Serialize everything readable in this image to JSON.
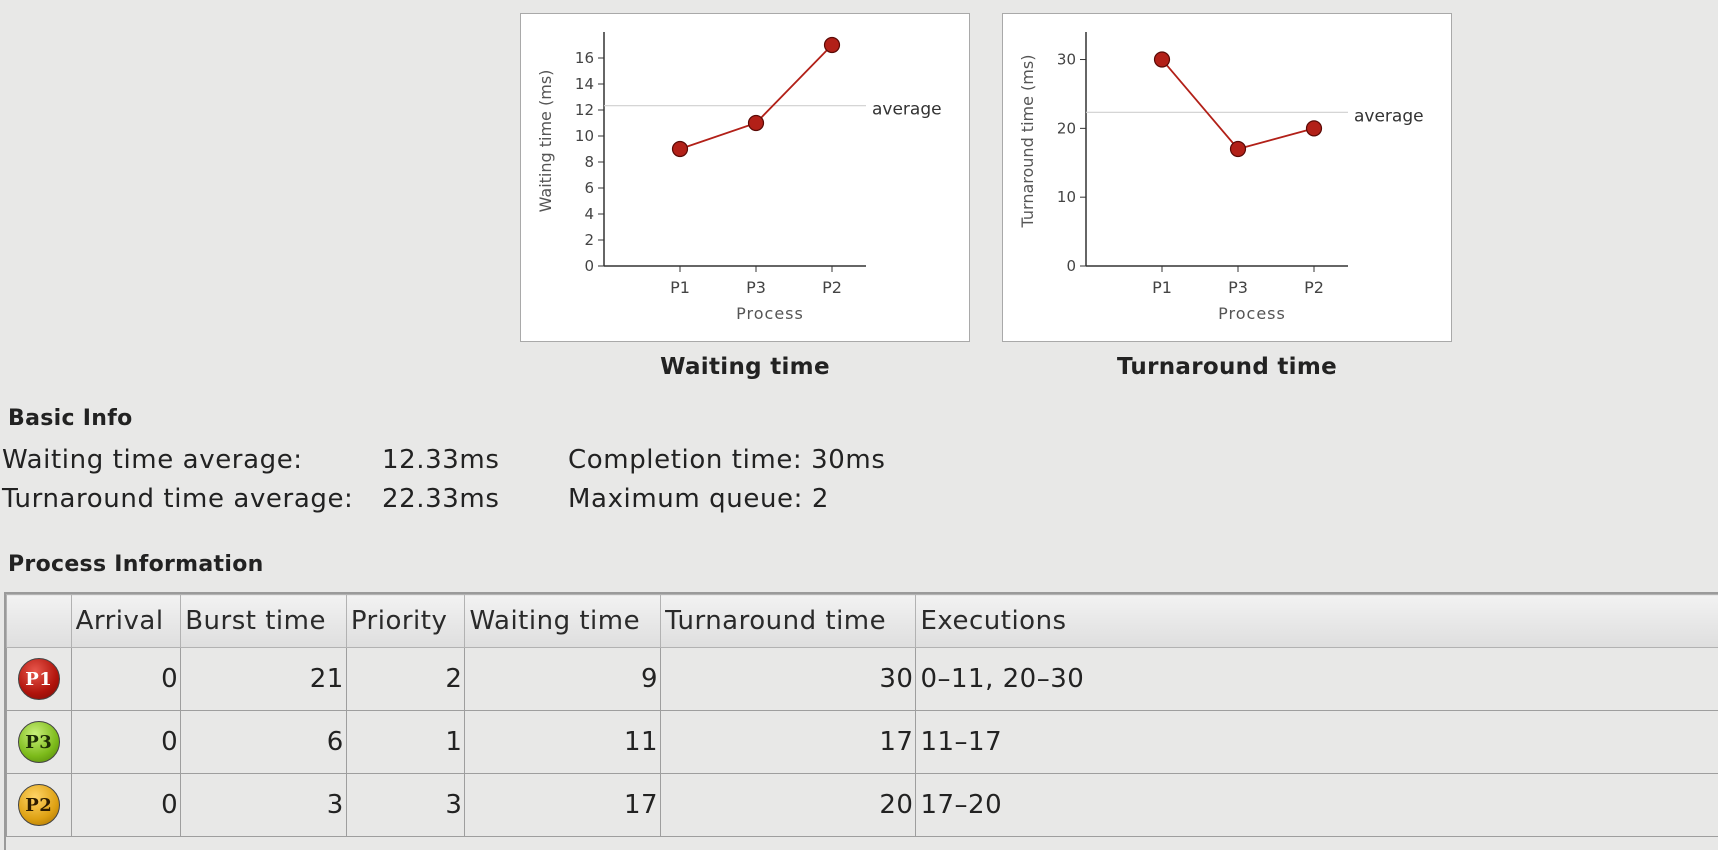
{
  "charts": [
    {
      "title": "Waiting time",
      "chart_data": {
        "type": "line",
        "categories": [
          "P1",
          "P3",
          "P2"
        ],
        "values": [
          9,
          11,
          17
        ],
        "average": 12.33,
        "average_label": "average",
        "xlabel": "Process",
        "ylabel": "Waiting time (ms)",
        "ylim": [
          0,
          18
        ],
        "yticks": [
          0,
          2,
          4,
          6,
          8,
          10,
          12,
          14,
          16
        ],
        "color": "#b22018"
      }
    },
    {
      "title": "Turnaround time",
      "chart_data": {
        "type": "line",
        "categories": [
          "P1",
          "P3",
          "P2"
        ],
        "values": [
          30,
          17,
          20
        ],
        "average": 22.33,
        "average_label": "average",
        "xlabel": "Process",
        "ylabel": "Turnaround time (ms)",
        "ylim": [
          0,
          34
        ],
        "yticks": [
          0,
          10,
          20,
          30
        ],
        "color": "#b22018"
      }
    }
  ],
  "basic_info": {
    "title": "Basic Info",
    "waiting_label": "Waiting time average:",
    "waiting_value": "12.33ms",
    "turnaround_label": "Turnaround time average:",
    "turnaround_value": "22.33ms",
    "completion": "Completion time: 30ms",
    "max_queue": "Maximum queue: 2"
  },
  "process_info": {
    "title": "Process Information",
    "columns": [
      "",
      "Arrival",
      "Burst time",
      "Priority",
      "Waiting time",
      "Turnaround time",
      "Executions"
    ],
    "rows": [
      {
        "badge": "P1",
        "badge_color": "#c0201a",
        "arrival": "0",
        "burst": "21",
        "priority": "2",
        "waiting": "9",
        "turnaround": "30",
        "executions": "0–11, 20–30"
      },
      {
        "badge": "P3",
        "badge_color": "#8cc43a",
        "arrival": "0",
        "burst": "6",
        "priority": "1",
        "waiting": "11",
        "turnaround": "17",
        "executions": "11–17"
      },
      {
        "badge": "P2",
        "badge_color": "#e0a020",
        "arrival": "0",
        "burst": "3",
        "priority": "3",
        "waiting": "17",
        "turnaround": "20",
        "executions": "17–20"
      }
    ]
  }
}
